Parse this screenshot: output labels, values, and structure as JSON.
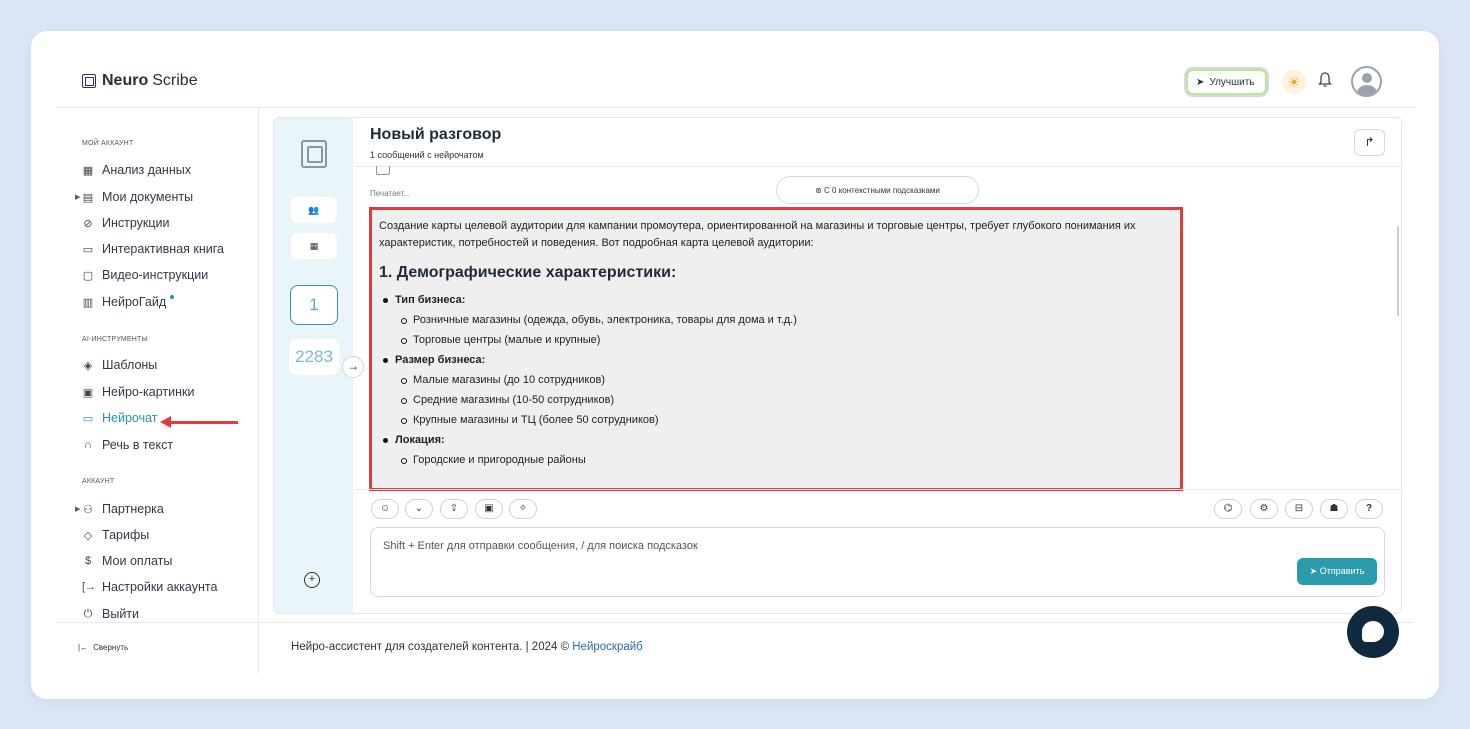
{
  "header": {
    "logo_bold": "Neuro",
    "logo_regular": "Scribe",
    "upgrade_label": "Улучшить"
  },
  "sidebar": {
    "section_account": "МОЙ АККАУНТ",
    "account_items": [
      {
        "label": "Анализ данных",
        "icon": "grid-icon"
      },
      {
        "label": "Мои документы",
        "icon": "document-icon"
      },
      {
        "label": "Инструкции",
        "icon": "help-circle-icon"
      },
      {
        "label": "Интерактивная книга",
        "icon": "book-icon"
      },
      {
        "label": "Видео-инструкции",
        "icon": "video-icon"
      },
      {
        "label": "НейроГайд",
        "icon": "table-icon"
      }
    ],
    "section_ai": "AI-ИНСТРУМЕНТЫ",
    "ai_items": [
      {
        "label": "Шаблоны",
        "icon": "layers-icon"
      },
      {
        "label": "Нейро-картинки",
        "icon": "image-icon"
      },
      {
        "label": "Нейрочат",
        "icon": "chat-icon"
      },
      {
        "label": "Речь в текст",
        "icon": "headphones-icon"
      }
    ],
    "section_acc2": "АККАУНТ",
    "acc2_items": [
      {
        "label": "Партнерка",
        "icon": "users-icon"
      },
      {
        "label": "Тарифы",
        "icon": "tag-icon"
      },
      {
        "label": "Мои оплаты",
        "icon": "dollar-icon"
      },
      {
        "label": "Настройки аккаунта",
        "icon": "login-icon"
      },
      {
        "label": "Выйти",
        "icon": "power-icon"
      }
    ],
    "collapse_label": "Свернуть"
  },
  "rail": {
    "count_active": "1",
    "count_total": "2283"
  },
  "conversation": {
    "title": "Новый разговор",
    "subtitle": "1 сообщений с нейрочатом",
    "typing": "Печатает...",
    "hints_pill": "С 0 контекстными подсказками"
  },
  "response": {
    "intro": "Создание карты целевой аудитории для кампании промоутера, ориентированной на магазины и торговые центры, требует глубокого понимания их характеристик, потребностей и поведения. Вот подробная карта целевой аудитории:",
    "heading": "1. Демографические характеристики:",
    "groups": [
      {
        "title": "Тип бизнеса:",
        "items": [
          "Розничные магазины (одежда, обувь, электроника, товары для дома и т.д.)",
          "Торговые центры (малые и крупные)"
        ]
      },
      {
        "title": "Размер бизнеса:",
        "items": [
          "Малые магазины (до 10 сотрудников)",
          "Средние магазины (10-50 сотрудников)",
          "Крупные магазины и ТЦ (более 50 сотрудников)"
        ]
      },
      {
        "title": "Локация:",
        "items": [
          "Городские и пригородные районы"
        ]
      }
    ]
  },
  "input": {
    "placeholder": "Shift + Enter для отправки сообщения, / для поиска подсказок",
    "send_label": "Отправить"
  },
  "footer": {
    "text": "Нейро-ассистент для создателей контента.  | 2024 © ",
    "brand": "Нейроскрайб"
  }
}
